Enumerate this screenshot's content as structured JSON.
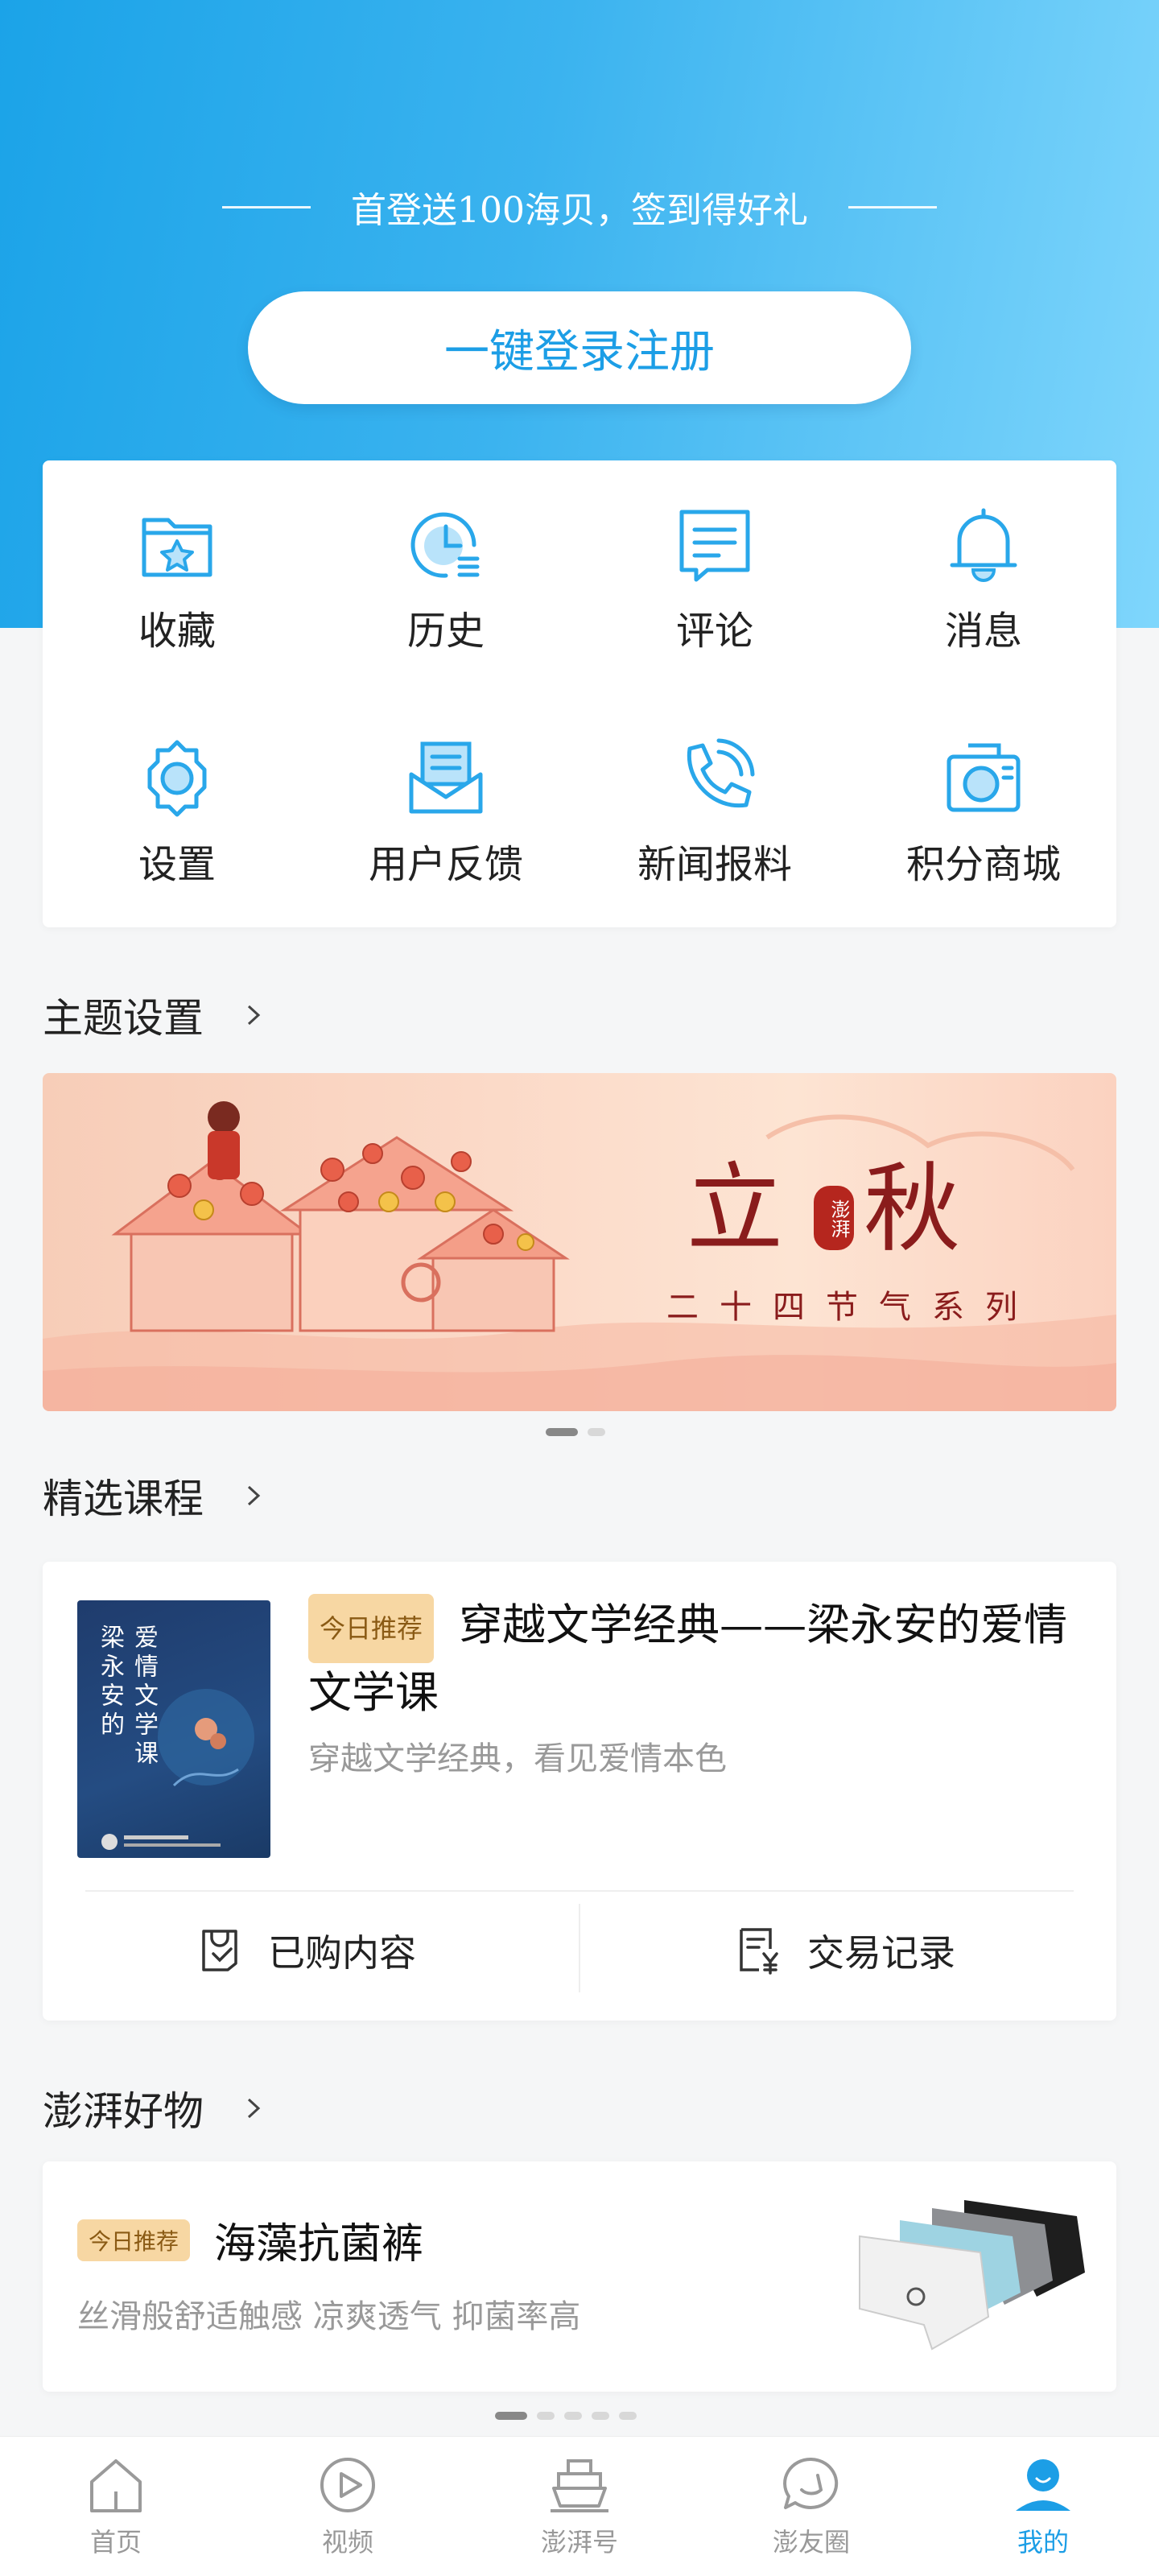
{
  "header": {
    "promo_text": "首登送100海贝，签到得好礼",
    "login_button": "一键登录注册"
  },
  "quick_actions": [
    {
      "label": "收藏",
      "icon": "folder-star-icon"
    },
    {
      "label": "历史",
      "icon": "clock-history-icon"
    },
    {
      "label": "评论",
      "icon": "comment-icon"
    },
    {
      "label": "消息",
      "icon": "bell-icon"
    },
    {
      "label": "设置",
      "icon": "gear-icon"
    },
    {
      "label": "用户反馈",
      "icon": "mail-icon"
    },
    {
      "label": "新闻报料",
      "icon": "phone-icon"
    },
    {
      "label": "积分商城",
      "icon": "camera-shop-icon"
    }
  ],
  "theme_section": {
    "title": "主题设置",
    "banner_title_left": "立",
    "banner_title_right": "秋",
    "banner_seal": "澎湃",
    "banner_subtitle": "二十四节气系列",
    "page_count": 2,
    "active_page": 1
  },
  "course_section": {
    "title": "精选课程",
    "tag": "今日推荐",
    "course_title": "穿越文学经典——梁永安的爱情文学课",
    "course_subtitle": "穿越文学经典，看见爱情本色",
    "cover_text_1": "梁永安的",
    "cover_text_2": "爱情文学课",
    "purchased_label": "已购内容",
    "transactions_label": "交易记录"
  },
  "goods_section": {
    "title": "澎湃好物",
    "tag": "今日推荐",
    "product_title": "海藻抗菌裤",
    "product_subtitle": "丝滑般舒适触感  凉爽透气  抑菌率高",
    "page_count": 5,
    "active_page": 1
  },
  "tabbar": [
    {
      "label": "首页",
      "icon": "home-icon"
    },
    {
      "label": "视频",
      "icon": "play-icon"
    },
    {
      "label": "澎湃号",
      "icon": "ship-icon"
    },
    {
      "label": "澎友圈",
      "icon": "chat-bubble-icon"
    },
    {
      "label": "我的",
      "icon": "user-icon",
      "active": true
    }
  ],
  "colors": {
    "accent": "#1c9ee6",
    "icon_stroke": "#29a7ea",
    "icon_fill": "#b9e3fa",
    "tag_bg": "#f7d7a3",
    "banner_red": "#8a1c1c"
  }
}
